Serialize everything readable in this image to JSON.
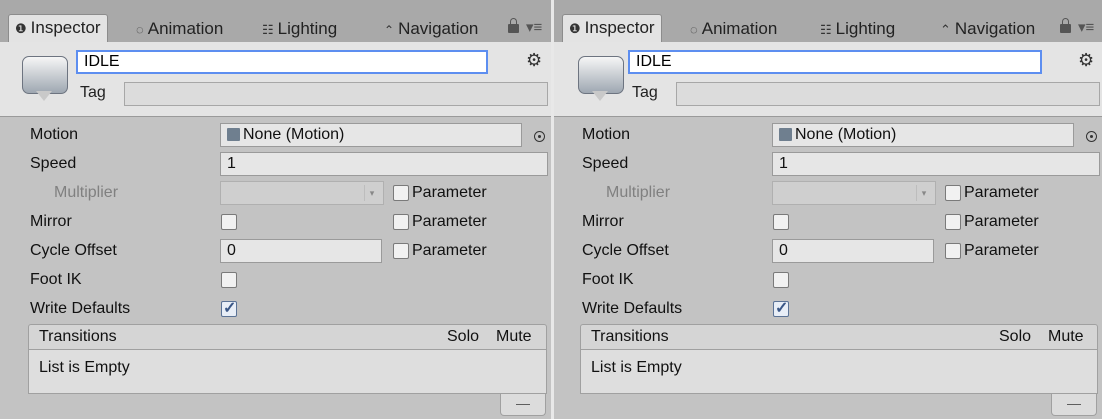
{
  "panels": [
    {
      "tabs": {
        "inspector": "Inspector",
        "animation": "Animation",
        "lighting": "Lighting",
        "navigation": "Navigation"
      },
      "state_name": "IDLE",
      "tag_label": "Tag",
      "tag_value": "",
      "rows": {
        "motion_label": "Motion",
        "motion_value": "None (Motion)",
        "speed_label": "Speed",
        "speed_value": "1",
        "multiplier_label": "Multiplier",
        "mirror_label": "Mirror",
        "cycle_offset_label": "Cycle Offset",
        "cycle_offset_value": "0",
        "foot_ik_label": "Foot IK",
        "write_defaults_label": "Write Defaults",
        "parameter_label": "Parameter"
      },
      "checks": {
        "mirror": false,
        "foot_ik": false,
        "write_defaults": true,
        "multiplier_param": false,
        "mirror_param": false,
        "cycle_offset_param": false
      },
      "transitions": {
        "title": "Transitions",
        "solo": "Solo",
        "mute": "Mute",
        "empty": "List is Empty",
        "remove": "—"
      }
    },
    {
      "tabs": {
        "inspector": "Inspector",
        "animation": "Animation",
        "lighting": "Lighting",
        "navigation": "Navigation"
      },
      "state_name": "IDLE",
      "tag_label": "Tag",
      "tag_value": "",
      "rows": {
        "motion_label": "Motion",
        "motion_value": "None (Motion)",
        "speed_label": "Speed",
        "speed_value": "1",
        "multiplier_label": "Multiplier",
        "mirror_label": "Mirror",
        "cycle_offset_label": "Cycle Offset",
        "cycle_offset_value": "0",
        "foot_ik_label": "Foot IK",
        "write_defaults_label": "Write Defaults",
        "parameter_label": "Parameter"
      },
      "checks": {
        "mirror": false,
        "foot_ik": false,
        "write_defaults": true,
        "multiplier_param": false,
        "mirror_param": false,
        "cycle_offset_param": false
      },
      "transitions": {
        "title": "Transitions",
        "solo": "Solo",
        "mute": "Mute",
        "empty": "List is Empty",
        "remove": "—"
      }
    }
  ]
}
